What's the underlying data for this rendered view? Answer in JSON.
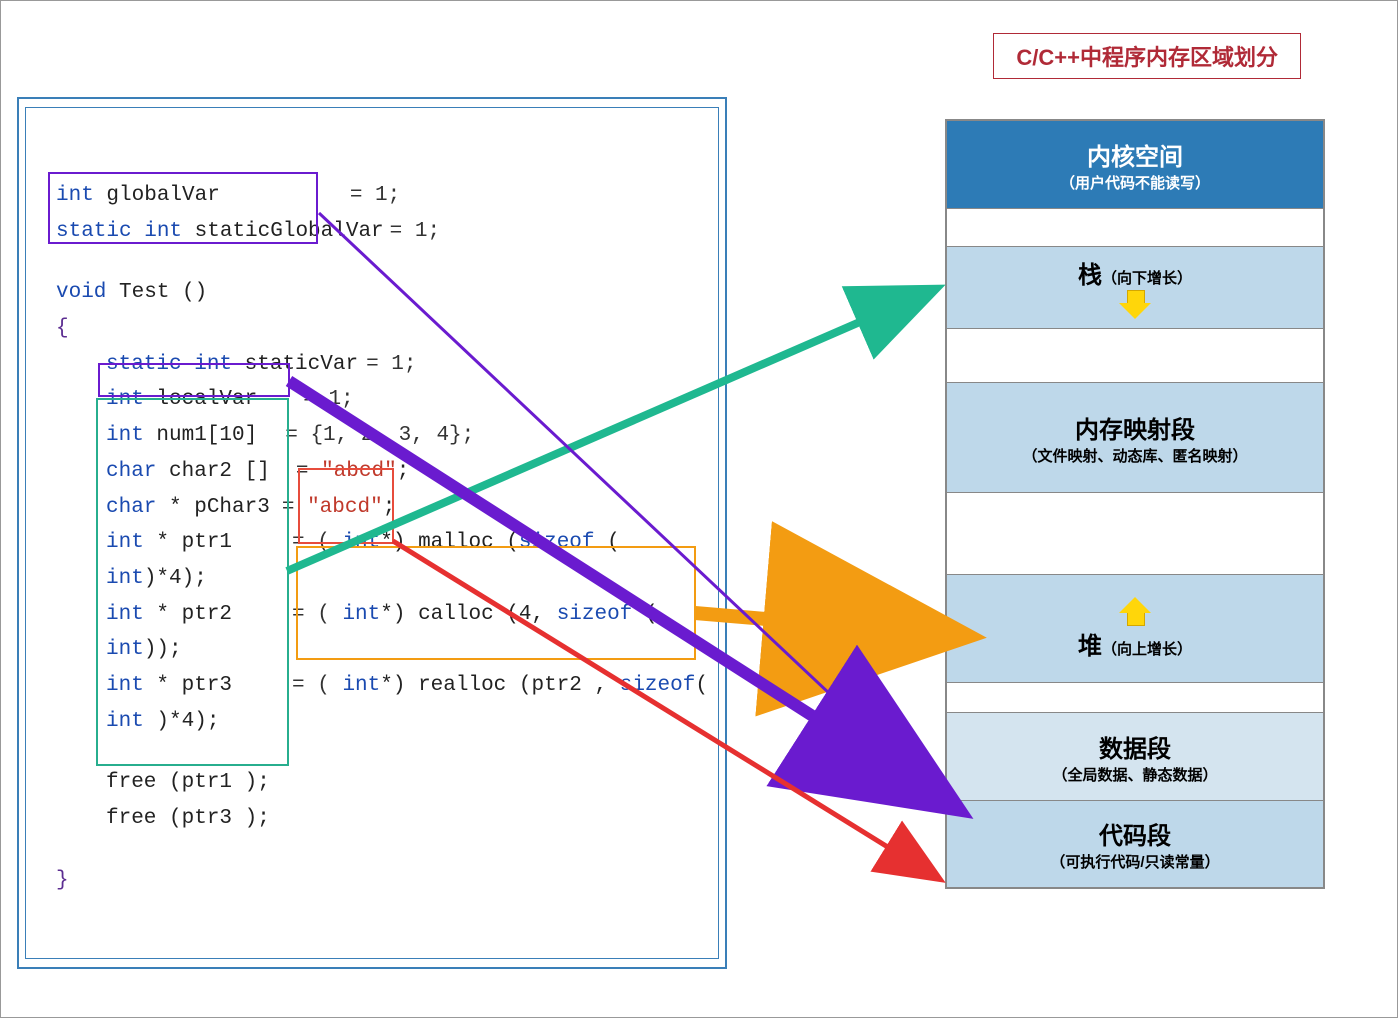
{
  "title": "C/C++中程序内存区域划分",
  "memory": {
    "kernel": {
      "title": "内核空间",
      "sub": "（用户代码不能读写）"
    },
    "stack": {
      "title": "栈",
      "sub": "（向下增长）"
    },
    "mmap": {
      "title": "内存映射段",
      "sub": "（文件映射、动态库、匿名映射）"
    },
    "heap": {
      "title": "堆",
      "sub": "（向上增长）"
    },
    "data": {
      "title": "数据段",
      "sub": "（全局数据、静态数据）"
    },
    "code": {
      "title": "代码段",
      "sub": "（可执行代码/只读常量）"
    }
  },
  "code": {
    "l1a": "int",
    "l1b": " globalVar",
    "l1c": "= 1;",
    "l2a": "static int",
    "l2b": " staticGlobalVar",
    "l2c": "= 1;",
    "l3a": "void",
    "l3b": " Test ()",
    "l4": "{",
    "l5a": "static int",
    "l5b": " staticVar",
    "l5c": "= 1;",
    "l6a": "int",
    "l6b": " localVar",
    "l6c": "= 1;",
    "l7a": "int",
    "l7b": " num1[10]",
    "l7c": "= {1, 2, 3, 4};",
    "l8a": "char",
    "l8b": " char2 []",
    "l8c": "= ",
    "l8d": "\"abcd\"",
    "l8e": ";",
    "l9a": "char",
    "l9b": " * pChar3",
    "l9c": "= ",
    "l9d": "\"abcd\"",
    "l9e": ";",
    "l10a": "int",
    "l10b": " * ptr1",
    "l10c": "= ( ",
    "l10d": "int",
    "l10e": "*) malloc (",
    "l10f": "sizeof",
    "l10g": " ( ",
    "l10h": " int",
    "l10i": ")*4);",
    "l11a": "int",
    "l11b": " * ptr2",
    "l11c": "= ( ",
    "l11d": "int",
    "l11e": "*) calloc (4, ",
    "l11f": "sizeof",
    "l11g": " ( ",
    "l11h": " int",
    "l11i": "));",
    "l12a": "int",
    "l12b": " * ptr3",
    "l12c": "= ( ",
    "l12d": "int",
    "l12e": "*) realloc (ptr2 , ",
    "l12f": "sizeof",
    "l12g": "( ",
    "l12h": "int",
    "l12i": " )*4);",
    "l13": "free (ptr1 );",
    "l14": "free (ptr3 );",
    "l15": "}"
  }
}
